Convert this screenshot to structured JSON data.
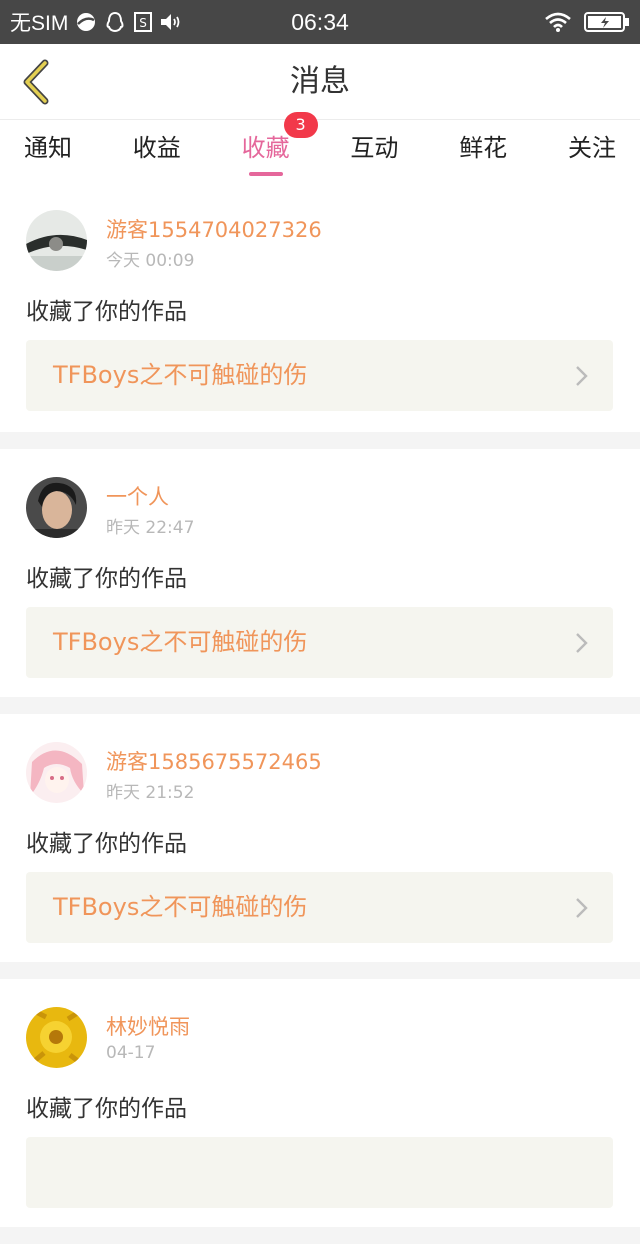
{
  "status_bar": {
    "carrier": "无SIM",
    "time": "06:34"
  },
  "header": {
    "title": "消息"
  },
  "tabs": [
    {
      "label": "通知",
      "active": false
    },
    {
      "label": "收益",
      "active": false
    },
    {
      "label": "收藏",
      "active": true,
      "badge": "3"
    },
    {
      "label": "互动",
      "active": false
    },
    {
      "label": "鲜花",
      "active": false
    },
    {
      "label": "关注",
      "active": false
    }
  ],
  "notifications": [
    {
      "username": "游客1554704027326",
      "time": "今天 00:09",
      "action": "收藏了你的作品",
      "work_title": "TFBoys之不可触碰的伤"
    },
    {
      "username": "一个人",
      "time": "昨天 22:47",
      "action": "收藏了你的作品",
      "work_title": "TFBoys之不可触碰的伤"
    },
    {
      "username": "游客1585675572465",
      "time": "昨天 21:52",
      "action": "收藏了你的作品",
      "work_title": "TFBoys之不可触碰的伤"
    },
    {
      "username": "林妙悦雨",
      "time": "04-17",
      "action": "收藏了你的作品",
      "work_title": ""
    }
  ],
  "colors": {
    "accent": "#e5679b",
    "name": "#f0955a",
    "badge": "#f2394a",
    "back": "#e3cf52"
  }
}
